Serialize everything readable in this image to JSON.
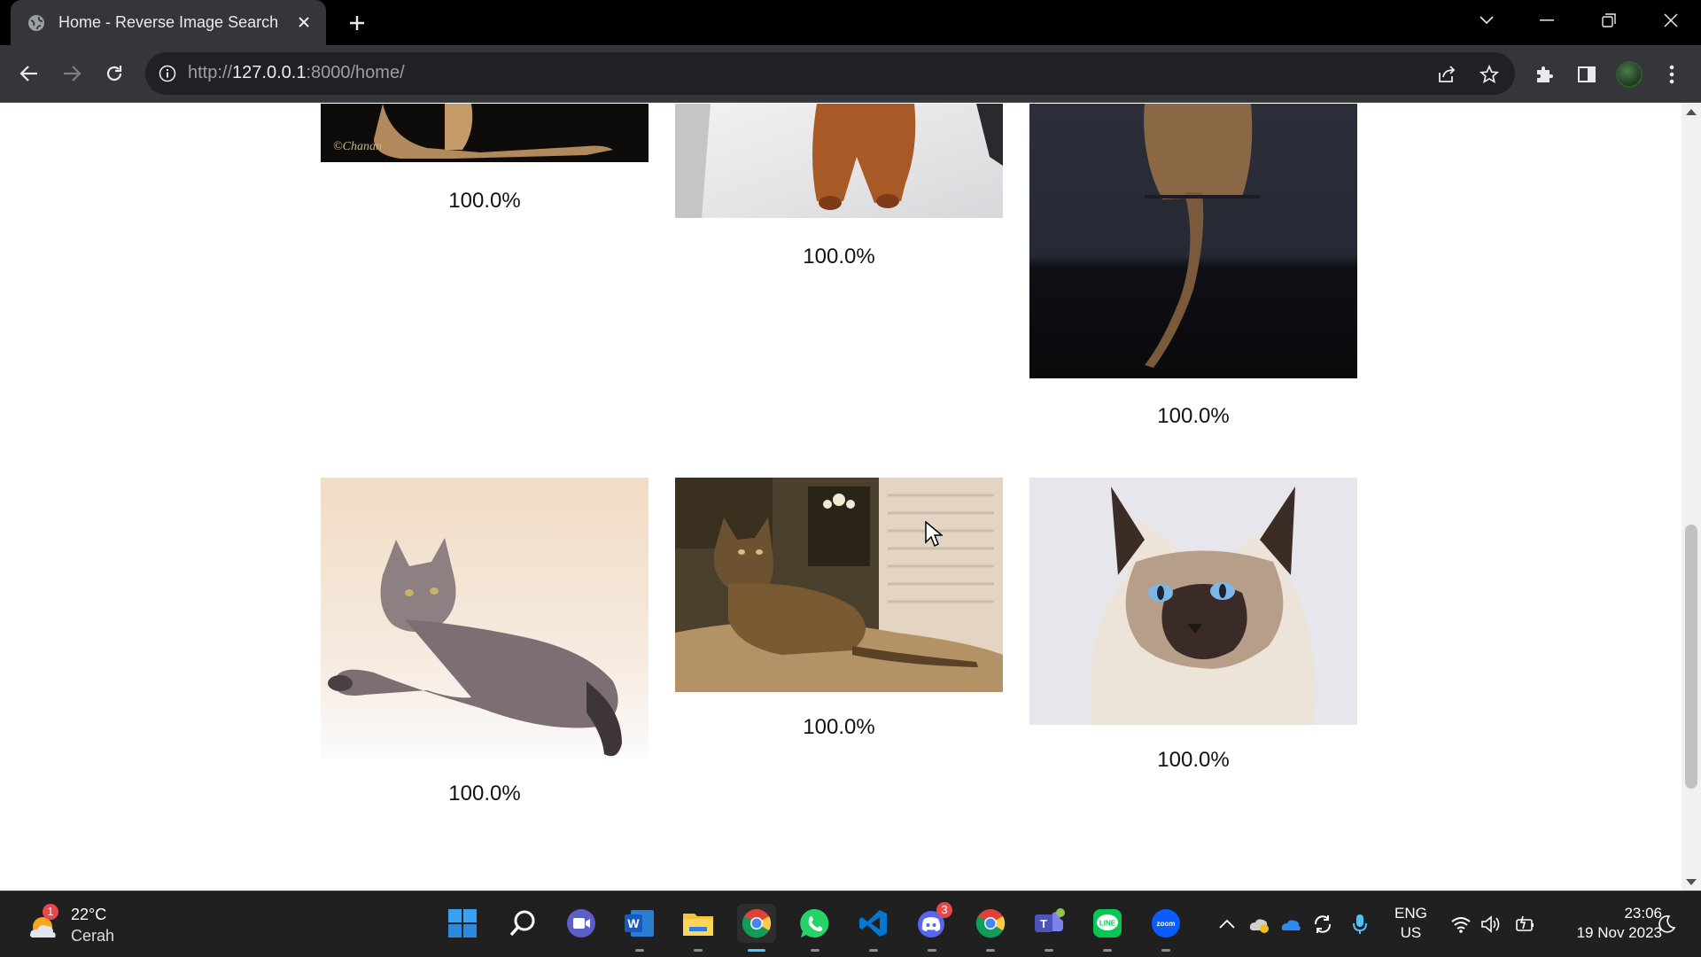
{
  "browser": {
    "tab_title": "Home - Reverse Image Search",
    "url_scheme": "http://",
    "url_host": "127.0.0.1",
    "url_rest": ":8000/home/"
  },
  "results": {
    "row1": [
      {
        "score": "100.0%",
        "image": "abyssinian-cat-dark-bg-signed"
      },
      {
        "score": "100.0%",
        "image": "ruddy-abyssinian-cat-white-bg"
      },
      {
        "score": "100.0%",
        "image": "abyssinian-cat-tail-dark-bg"
      }
    ],
    "row2": [
      {
        "score": "100.0%",
        "image": "blue-abyssinian-cat-lying"
      },
      {
        "score": "100.0%",
        "image": "tabby-cat-on-couch"
      },
      {
        "score": "100.0%",
        "image": "birman-cat-blue-eyes"
      }
    ]
  },
  "taskbar": {
    "weather_temp": "22°C",
    "weather_desc": "Cerah",
    "weather_badge": "1",
    "discord_badge": "3",
    "lang_line1": "ENG",
    "lang_line2": "US",
    "time": "23:06",
    "date": "19 Nov 2023",
    "apps": [
      "start-icon",
      "search-icon",
      "meet-icon",
      "word-icon",
      "file-explorer-icon",
      "chrome-icon",
      "whatsapp-icon",
      "vscode-icon",
      "discord-icon",
      "chrome-icon",
      "teams-icon",
      "line-icon",
      "zoom-icon"
    ]
  },
  "colors": {
    "chrome_dark": "#35363a",
    "taskbar": "#202020",
    "active_indicator": "#4cc2ff"
  }
}
